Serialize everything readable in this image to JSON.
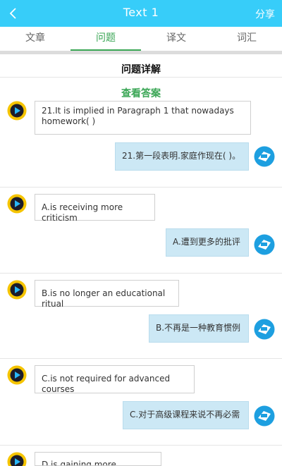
{
  "header": {
    "title": "Text 1",
    "share_label": "分享"
  },
  "tabs": [
    "文章",
    "问题",
    "译文",
    "词汇"
  ],
  "section_title": "问题详解",
  "answer_link": "查看答案",
  "items": [
    {
      "en": "21.It is implied in Paragraph 1 that nowadays homework( )",
      "cn": "21.第一段表明.家庭作现在( )。"
    },
    {
      "en": "A.is receiving more criticism",
      "cn": "A.遭到更多的批评"
    },
    {
      "en": "B.is no longer an educational ritual",
      "cn": "B.不再是一种教育惯例"
    },
    {
      "en": "C.is not required for advanced courses",
      "cn": "C.对于高级课程来说不再必需"
    },
    {
      "en": "D.is gaining more preferences",
      "cn": ""
    }
  ],
  "colors": {
    "header": "#37cdf9",
    "active_tab": "#3aa655",
    "cn_bubble": "#cce8f5"
  },
  "icons": {
    "back": "chevron-left-icon",
    "left_avatar": "video-play-avatar-icon",
    "right_avatar": "logo-avatar-icon"
  }
}
